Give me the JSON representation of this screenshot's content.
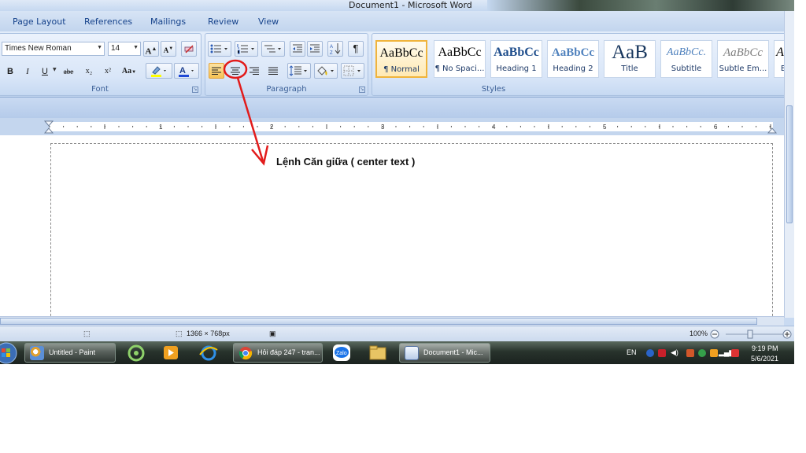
{
  "window": {
    "title": "Document1 - Microsoft Word"
  },
  "tabs": [
    {
      "label": "Page Layout"
    },
    {
      "label": "References"
    },
    {
      "label": "Mailings"
    },
    {
      "label": "Review"
    },
    {
      "label": "View"
    }
  ],
  "font_group": {
    "label": "Font",
    "font_name": "Times New Roman",
    "font_size": "14",
    "bold": "B",
    "italic": "I",
    "underline": "U",
    "strike": "abe",
    "subscript": "x₂",
    "superscript": "x²",
    "change_case": "Aa",
    "grow": "A",
    "shrink": "A"
  },
  "paragraph_group": {
    "label": "Paragraph",
    "pilcrow": "¶",
    "active_alignment": "center"
  },
  "styles_group": {
    "label": "Styles",
    "items": [
      {
        "sample": "AaBbCc",
        "name": "¶ Normal",
        "selected": true
      },
      {
        "sample": "AaBbCc",
        "name": "¶ No Spaci..."
      },
      {
        "sample": "AaBbCc",
        "name": "Heading 1"
      },
      {
        "sample": "AaBbCc",
        "name": "Heading 2"
      },
      {
        "sample": "AaB",
        "name": "Title"
      },
      {
        "sample": "AaBbCc.",
        "name": "Subtitle"
      },
      {
        "sample": "AaBbCc",
        "name": "Subtle Em..."
      },
      {
        "sample": "Aa",
        "name": "E"
      }
    ]
  },
  "ruler": {
    "numbers": [
      "1",
      "2",
      "3",
      "4",
      "5",
      "6"
    ]
  },
  "annotation": {
    "text": "Lệnh Căn giữa ( center text )"
  },
  "statusbar": {
    "dimensions": "1366 × 768px",
    "zoom": "100%"
  },
  "taskbar": {
    "items": [
      {
        "label": "Untitled - Paint"
      },
      {
        "label": "Hỏi đáp 247 - tran..."
      },
      {
        "label": "Document1 - Mic..."
      }
    ],
    "pins": [
      "zalo"
    ],
    "language": "EN",
    "time": "9:19 PM",
    "date": "5/6/2021"
  },
  "colors": {
    "ribbon": "#d5e3f6",
    "accent": "#f6c254",
    "annotation_red": "#e21b1b"
  }
}
